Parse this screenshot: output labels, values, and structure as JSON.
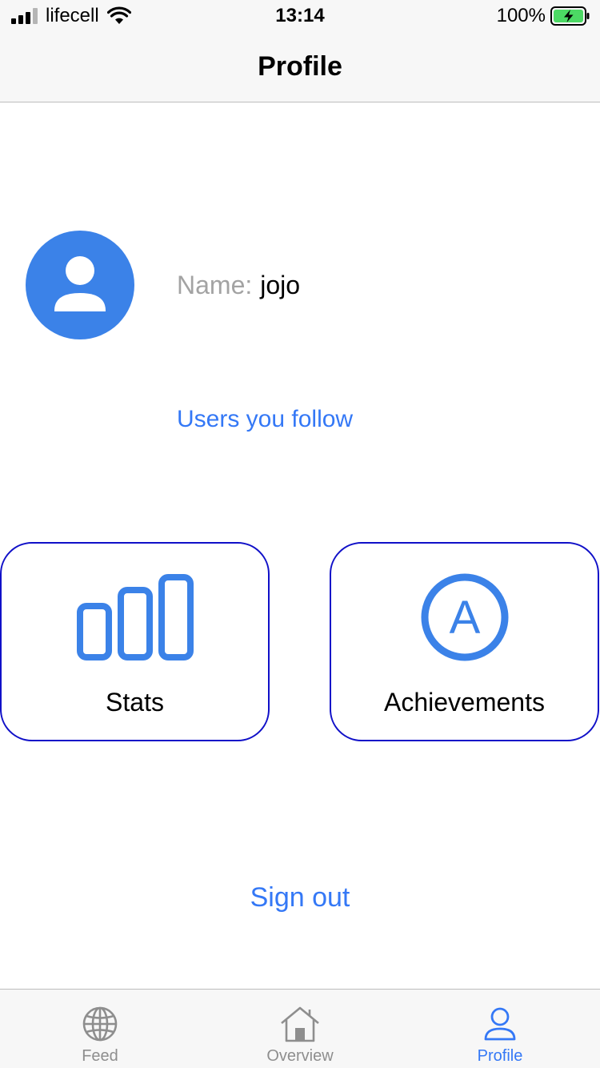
{
  "status_bar": {
    "carrier": "lifecell",
    "time": "13:14",
    "battery": "100%"
  },
  "nav": {
    "title": "Profile"
  },
  "profile": {
    "name_label": "Name:",
    "name_value": "jojo",
    "follow_link": "Users you follow"
  },
  "cards": {
    "stats_label": "Stats",
    "achievements_label": "Achievements",
    "achievements_letter": "A"
  },
  "signout_label": "Sign out",
  "tabs": [
    {
      "label": "Feed",
      "icon": "globe-icon"
    },
    {
      "label": "Overview",
      "icon": "home-icon"
    },
    {
      "label": "Profile",
      "icon": "person-icon"
    }
  ],
  "colors": {
    "accent": "#3478f6",
    "avatar": "#3b82e8",
    "card_border": "#1010c8"
  }
}
